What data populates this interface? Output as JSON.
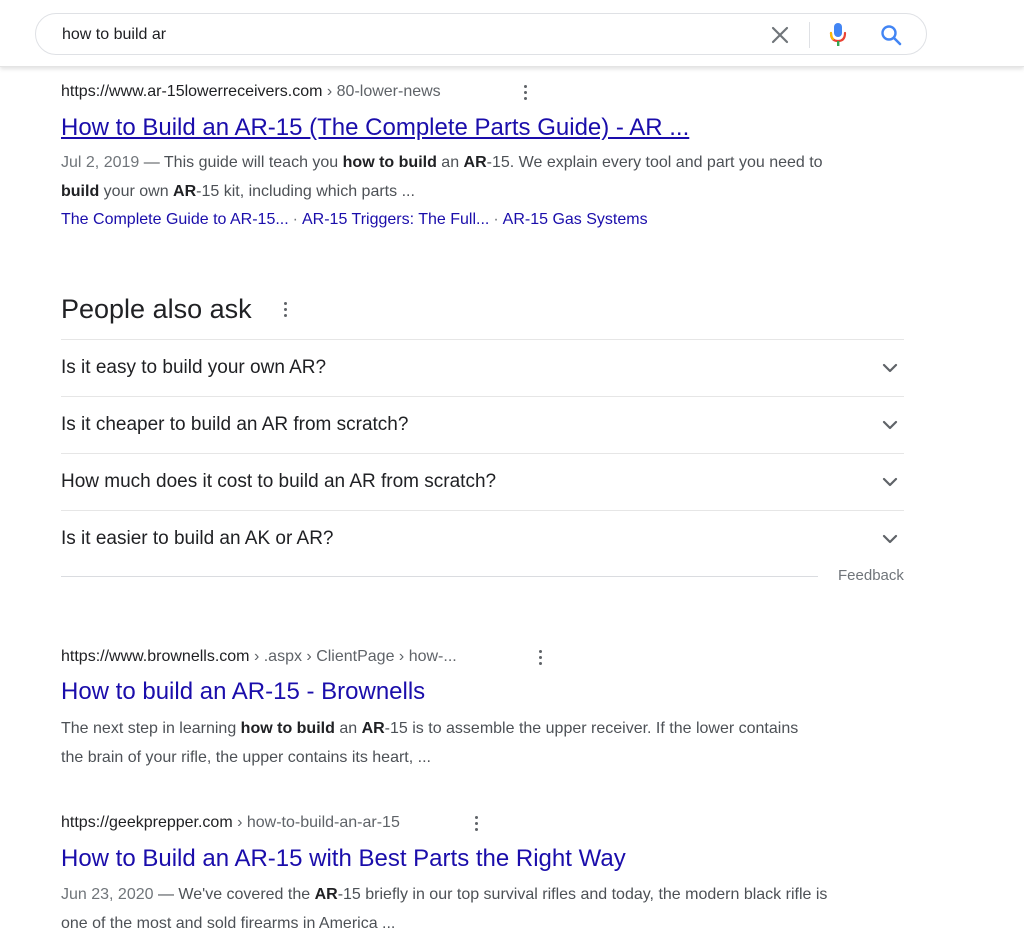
{
  "search": {
    "query": "how to build ar"
  },
  "results": [
    {
      "site": "https://www.ar-15lowerreceivers.com",
      "path": " › 80-lower-news",
      "title": "How to Build an AR-15 (The Complete Parts Guide) - AR ...",
      "date": "Jul 2, 2019",
      "dash": " — ",
      "snippet_parts": [
        "This guide will teach you ",
        "how to build",
        " an ",
        "AR",
        "-15. We explain every tool and part you need to ",
        "build",
        " your own ",
        "AR",
        "-15 kit, including which parts ..."
      ],
      "sitelinks": [
        "The Complete Guide to AR-15...",
        "AR-15 Triggers: The Full...",
        "AR-15 Gas Systems"
      ],
      "sitelink_sep": "·"
    },
    {
      "site": "https://www.brownells.com",
      "path": " › .aspx › ClientPage › how-...",
      "title": "How to build an AR-15 - Brownells",
      "snippet_parts": [
        "The next step in learning ",
        "how to build",
        " an ",
        "AR",
        "-15 is to assemble the upper receiver. If the lower contains the brain of your rifle, the upper contains its heart, ..."
      ]
    },
    {
      "site": "https://geekprepper.com",
      "path": " › how-to-build-an-ar-15",
      "title": "How to Build an AR-15 with Best Parts the Right Way",
      "date": "Jun 23, 2020",
      "dash": " — ",
      "snippet_parts": [
        "We've covered the ",
        "AR",
        "-15 briefly in our top survival rifles and today, the modern black rifle is one of the most and sold firearms in America ..."
      ]
    }
  ],
  "people_also_ask": {
    "title": "People also ask",
    "questions": [
      "Is it easy to build your own AR?",
      "Is it cheaper to build an AR from scratch?",
      "How much does it cost to build an AR from scratch?",
      "Is it easier to build an AK or AR?"
    ],
    "feedback": "Feedback"
  }
}
